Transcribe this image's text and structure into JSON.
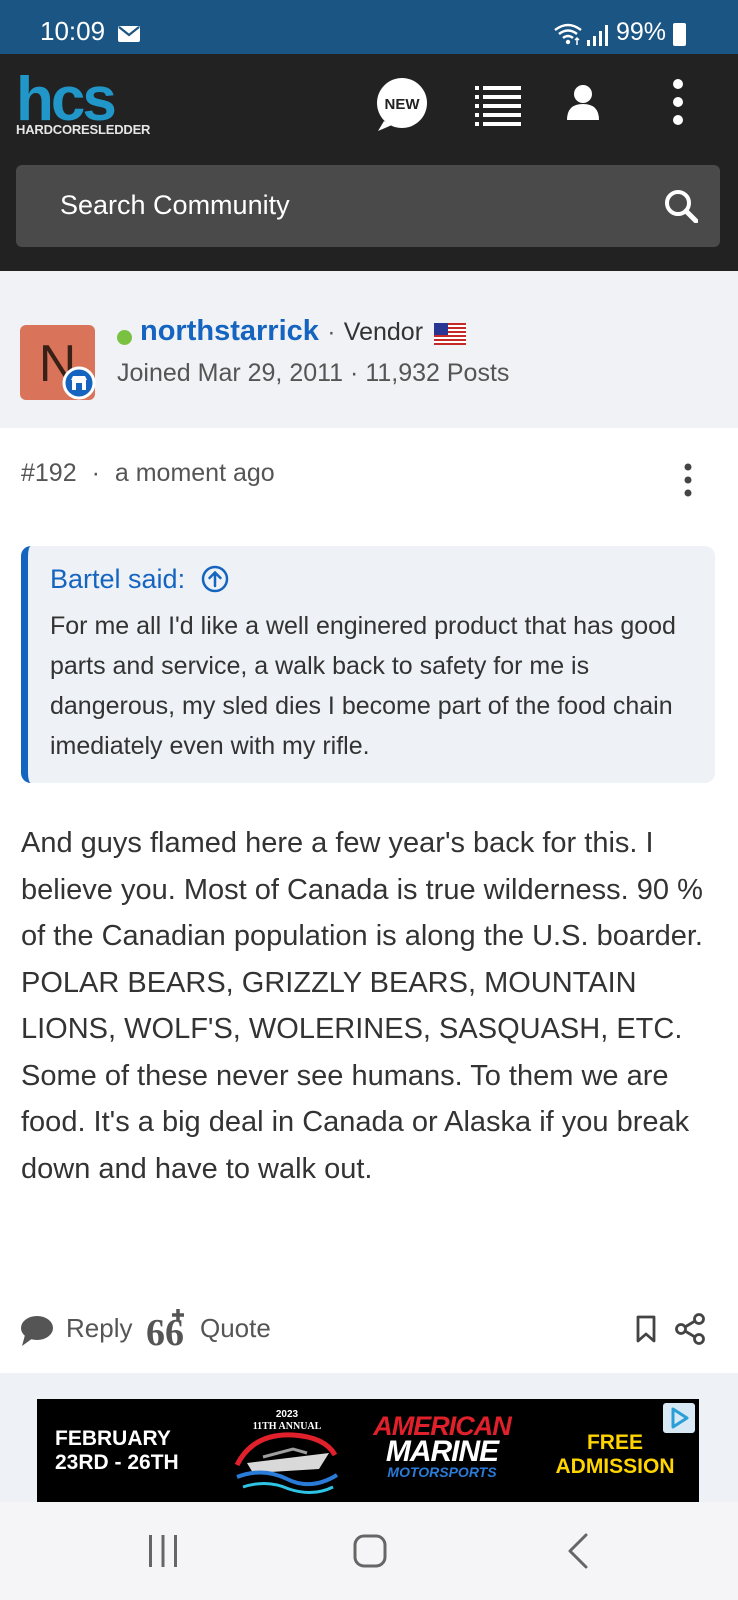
{
  "status_bar": {
    "time": "10:09",
    "battery": "99%"
  },
  "header": {
    "logo_text": "hcs",
    "logo_subtitle": "HARDCORESLEDDER",
    "new_badge": "NEW",
    "search_placeholder": "Search Community"
  },
  "author": {
    "avatar_letter": "N",
    "name": "northstarrick",
    "separator": "·",
    "role": "Vendor",
    "joined": "Joined Mar 29, 2011",
    "posts": "11,932 Posts",
    "online": true
  },
  "post": {
    "number": "#192",
    "time": "a moment ago",
    "quote": {
      "author": "Bartel said:",
      "text": "For me all I'd like a well enginered product that has good parts and service, a walk back to safety for me is dangerous, my sled dies I become part of the food chain imediately even with my rifle."
    },
    "body": "And guys flamed here a few year's back for this. I believe you. Most of Canada is true wilderness. 90 % of the Canadian population is along the U.S. boarder. POLAR BEARS, GRIZZLY BEARS, MOUNTAIN LIONS, WOLF'S, WOLERINES, SASQUASH, ETC. Some of these never see humans. To them we are food. It's a big deal in Canada or Alaska if you break down and have to walk out.",
    "actions": {
      "reply": "Reply",
      "quote": "Quote"
    }
  },
  "ad": {
    "date_line1": "FEBRUARY",
    "date_line2": "23RD - 26TH",
    "boat_year": "2023",
    "boat_annual": "11TH ANNUAL",
    "brand_line1": "AMERICAN",
    "brand_line2": "MARINE",
    "brand_line3": "MOTORSPORTS",
    "offer_line1": "FREE",
    "offer_line2": "ADMISSION"
  },
  "colors": {
    "status_bar": "#1b5583",
    "header": "#222222",
    "link": "#1565c0",
    "logo": "#2196c8",
    "online": "#7ac142"
  },
  "icons": [
    "mail-icon",
    "wifi-icon",
    "signal-icon",
    "battery-icon",
    "new-badge-icon",
    "list-icon",
    "user-icon",
    "more-vertical-icon",
    "search-icon",
    "vendor-badge-icon",
    "flag-icon",
    "arrow-up-circle-icon",
    "reply-icon",
    "quote-plus-icon",
    "bookmark-icon",
    "share-icon",
    "ad-choice-icon",
    "nav-recent-icon",
    "nav-home-icon",
    "nav-back-icon"
  ]
}
